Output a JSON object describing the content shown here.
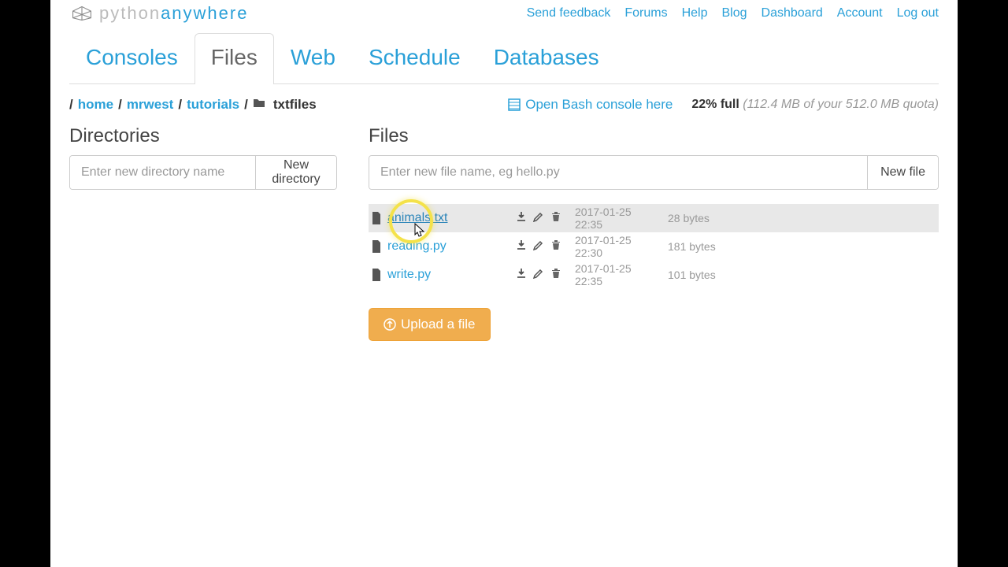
{
  "logo": {
    "python": "python",
    "anywhere": "anywhere"
  },
  "top_nav": {
    "send_feedback": "Send feedback",
    "forums": "Forums",
    "help": "Help",
    "blog": "Blog",
    "dashboard": "Dashboard",
    "account": "Account",
    "logout": "Log out"
  },
  "tabs": {
    "consoles": "Consoles",
    "files": "Files",
    "web": "Web",
    "schedule": "Schedule",
    "databases": "Databases"
  },
  "breadcrumb": {
    "home": "home",
    "user": "mrwest",
    "folder1": "tutorials",
    "current": "txtfiles"
  },
  "bash_link": "Open Bash console here",
  "quota": {
    "pct": "22% full",
    "detail": "(112.4 MB of your 512.0 MB quota)"
  },
  "directories": {
    "title": "Directories",
    "placeholder": "Enter new directory name",
    "button": "New directory"
  },
  "files_section": {
    "title": "Files",
    "placeholder": "Enter new file name, eg hello.py",
    "button": "New file",
    "items": [
      {
        "name": "animals.txt",
        "date": "2017-01-25 22:35",
        "size": "28 bytes",
        "highlighted": true
      },
      {
        "name": "reading.py",
        "date": "2017-01-25 22:30",
        "size": "181 bytes",
        "highlighted": false
      },
      {
        "name": "write.py",
        "date": "2017-01-25 22:35",
        "size": "101 bytes",
        "highlighted": false
      }
    ],
    "upload": "Upload a file"
  }
}
